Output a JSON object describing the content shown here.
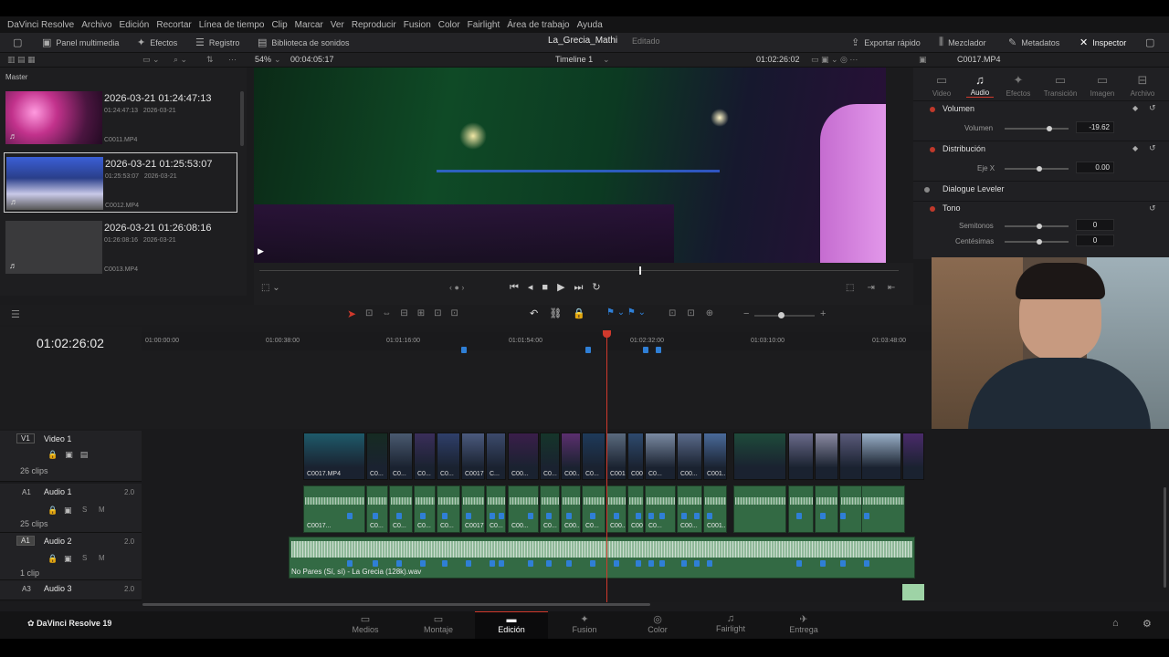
{
  "app": {
    "name": "DaVinci Resolve",
    "version_label": "DaVinci Resolve 19"
  },
  "menu": [
    "DaVinci Resolve",
    "Archivo",
    "Edición",
    "Recortar",
    "Línea de tiempo",
    "Clip",
    "Marcar",
    "Ver",
    "Reproducir",
    "Fusion",
    "Color",
    "Fairlight",
    "Área de trabajo",
    "Ayuda"
  ],
  "toolbar": {
    "panel_multimedia": "Panel multimedia",
    "efectos": "Efectos",
    "registro": "Registro",
    "biblioteca": "Biblioteca de sonidos",
    "project_title": "La_Grecia_Mathi",
    "project_status": "Editado",
    "exportar": "Exportar rápido",
    "mezclador": "Mezclador",
    "metadatos": "Metadatos",
    "inspector": "Inspector"
  },
  "viewer": {
    "zoom": "54%",
    "duration": "00:04:05:17",
    "timeline_name": "Timeline 1",
    "timecode": "01:02:26:02",
    "clip_name": "C0017.MP4"
  },
  "media_pool": {
    "header": "Master",
    "clips": [
      {
        "title": "2026-03-21  01:24:47:13",
        "time": "01:24:47:13",
        "date": "2026-03-21",
        "file": "C0011.MP4"
      },
      {
        "title": "2026-03-21  01:25:53:07",
        "time": "01:25:53:07",
        "date": "2026-03-21",
        "file": "C0012.MP4"
      },
      {
        "title": "2026-03-21  01:26:08:16",
        "time": "01:26:08:16",
        "date": "2026-03-21",
        "file": "C0013.MP4"
      }
    ]
  },
  "inspector": {
    "tabs": [
      {
        "label": "Video",
        "icon": "video-icon"
      },
      {
        "label": "Audio",
        "icon": "audio-icon"
      },
      {
        "label": "Efectos",
        "icon": "effects-icon"
      },
      {
        "label": "Transición",
        "icon": "transition-icon"
      },
      {
        "label": "Imagen",
        "icon": "image-icon"
      },
      {
        "label": "Archivo",
        "icon": "file-icon"
      }
    ],
    "volumen_section": "Volumen",
    "volumen_label": "Volumen",
    "volumen_value": "-19.62",
    "distribucion_section": "Distribución",
    "eje_label": "Eje X",
    "eje_value": "0.00",
    "dialogue": "Dialogue Leveler",
    "tono_section": "Tono",
    "semitonos_label": "Semitonos",
    "semitonos_value": "0",
    "centesimas_label": "Centésimas",
    "centesimas_value": "0"
  },
  "timeline": {
    "timecode": "01:02:26:02",
    "ruler": [
      "01:00:00:00",
      "01:00:38:00",
      "01:01:16:00",
      "01:01:54:00",
      "01:02:32:00",
      "01:03:10:00",
      "01:03:48:00"
    ],
    "tracks": {
      "v1": {
        "tag": "V1",
        "name": "Video 1",
        "count": "26 clips"
      },
      "a1": {
        "tag": "A1",
        "name": "Audio 1",
        "level": "2.0",
        "count": "25 clips"
      },
      "a2": {
        "tag": "A1",
        "name": "Audio 2",
        "level": "2.0",
        "count": "1 clip"
      },
      "a3": {
        "tag": "A3",
        "name": "Audio 3",
        "level": "2.0"
      }
    },
    "video_clip_labels": [
      "C0017.MP4",
      "C0...",
      "C0...",
      "C0...",
      "C0...",
      "C0017...",
      "C...",
      "C00...",
      "C0...",
      "C00...",
      "C0...",
      "C0017.M...",
      "C00...",
      "C0...",
      "C00...",
      "C001..."
    ],
    "audio_clip_labels": [
      "C0017...",
      "C0...",
      "C0...",
      "C0...",
      "C0...",
      "C0017...",
      "C0...",
      "C00...",
      "C0...",
      "C00...",
      "C0...",
      "C00...",
      "C00...",
      "C0...",
      "C00...",
      "C001..."
    ],
    "music_clip": "No Pares (Sí, sí) - La Grecia (128k).wav",
    "solo_label": "S",
    "mute_label": "M"
  },
  "pages": [
    "Medios",
    "Montaje",
    "Edición",
    "Fusion",
    "Color",
    "Fairlight",
    "Entrega"
  ],
  "colors": {
    "accent": "#d0392c",
    "video_clip": "#2c3e5a",
    "audio_clip": "#336a44",
    "marker": "#2f7fd6"
  }
}
